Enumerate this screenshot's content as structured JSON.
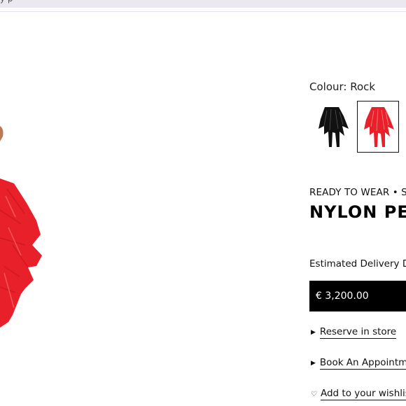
{
  "top_bar": {
    "partial_text": "y p"
  },
  "colour": {
    "label": "Colour: Rock"
  },
  "swatches": [
    {
      "name": "black",
      "color": "#111111",
      "selected": false
    },
    {
      "name": "red",
      "color": "#e8202a",
      "selected": true
    }
  ],
  "product": {
    "category": "READY TO WEAR • S",
    "title": "NYLON PET"
  },
  "delivery": {
    "label": "Estimated Delivery Da"
  },
  "price": {
    "value": "€ 3,200.00"
  },
  "actions": {
    "reserve": "Reserve in store",
    "appointment": "Book An Appointme",
    "wishlist": "Add to your wishlist"
  },
  "colors": {
    "accent_red": "#e8202a",
    "button_bg": "#000000"
  }
}
